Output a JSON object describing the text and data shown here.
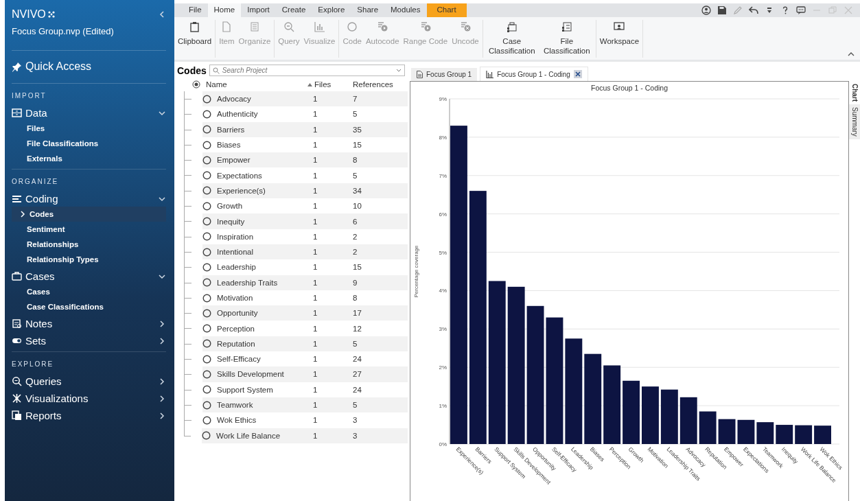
{
  "sidebar": {
    "logo": "NVIVO",
    "project": "Focus Group.nvp (Edited)",
    "quick_access": "Quick Access",
    "sections": [
      {
        "heading": "IMPORT",
        "groups": [
          {
            "label": "Data",
            "expanded": true,
            "children": [
              {
                "label": "Files",
                "selected": false
              },
              {
                "label": "File Classifications",
                "selected": false
              },
              {
                "label": "Externals",
                "selected": false
              }
            ]
          }
        ]
      },
      {
        "heading": "ORGANIZE",
        "groups": [
          {
            "label": "Coding",
            "expanded": true,
            "children": [
              {
                "label": "Codes",
                "selected": true
              },
              {
                "label": "Sentiment",
                "selected": false
              },
              {
                "label": "Relationships",
                "selected": false
              },
              {
                "label": "Relationship Types",
                "selected": false
              }
            ]
          },
          {
            "label": "Cases",
            "expanded": true,
            "children": [
              {
                "label": "Cases",
                "selected": false
              },
              {
                "label": "Case Classifications",
                "selected": false
              }
            ]
          },
          {
            "label": "Notes",
            "expanded": false
          },
          {
            "label": "Sets",
            "expanded": false
          }
        ]
      },
      {
        "heading": "EXPLORE",
        "groups": [
          {
            "label": "Queries",
            "expanded": false
          },
          {
            "label": "Visualizations",
            "expanded": false
          },
          {
            "label": "Reports",
            "expanded": false
          }
        ]
      }
    ]
  },
  "ribbon": {
    "tabs": [
      {
        "label": "File",
        "selected": false,
        "kind": "plain"
      },
      {
        "label": "Home",
        "selected": true,
        "kind": "plain"
      },
      {
        "label": "Import",
        "selected": false,
        "kind": "plain"
      },
      {
        "label": "Create",
        "selected": false,
        "kind": "plain"
      },
      {
        "label": "Explore",
        "selected": false,
        "kind": "plain"
      },
      {
        "label": "Share",
        "selected": false,
        "kind": "plain"
      },
      {
        "label": "Modules",
        "selected": false,
        "kind": "plain"
      },
      {
        "label": "Chart",
        "selected": false,
        "kind": "context"
      }
    ],
    "groups": [
      [
        {
          "label": "Clipboard",
          "disabled": false
        }
      ],
      [
        {
          "label": "Item",
          "disabled": true
        },
        {
          "label": "Organize",
          "disabled": true
        }
      ],
      [
        {
          "label": "Query",
          "disabled": true
        },
        {
          "label": "Visualize",
          "disabled": true
        }
      ],
      [
        {
          "label": "Code",
          "disabled": true
        },
        {
          "label": "Autocode",
          "disabled": true
        },
        {
          "label": "Range Code",
          "disabled": true
        },
        {
          "label": "Uncode",
          "disabled": true
        }
      ],
      [
        {
          "label": "Case Classification",
          "disabled": false
        },
        {
          "label": "File Classification",
          "disabled": false
        }
      ],
      [
        {
          "label": "Workspace",
          "disabled": false
        }
      ]
    ]
  },
  "codes": {
    "title": "Codes",
    "search": {
      "placeholder": "Search Project"
    },
    "columns": [
      "Name",
      "Files",
      "References"
    ],
    "rows": [
      {
        "name": "Advocacy",
        "files": "1",
        "references": "7"
      },
      {
        "name": "Authenticity",
        "files": "1",
        "references": "5"
      },
      {
        "name": "Barriers",
        "files": "1",
        "references": "35"
      },
      {
        "name": "Biases",
        "files": "1",
        "references": "15"
      },
      {
        "name": "Empower",
        "files": "1",
        "references": "8"
      },
      {
        "name": "Expectations",
        "files": "1",
        "references": "5"
      },
      {
        "name": "Experience(s)",
        "files": "1",
        "references": "34"
      },
      {
        "name": "Growth",
        "files": "1",
        "references": "10"
      },
      {
        "name": "Inequity",
        "files": "1",
        "references": "6"
      },
      {
        "name": "Inspiration",
        "files": "1",
        "references": "2"
      },
      {
        "name": "Intentional",
        "files": "1",
        "references": "2"
      },
      {
        "name": "Leadership",
        "files": "1",
        "references": "15"
      },
      {
        "name": "Leadership Traits",
        "files": "1",
        "references": "9"
      },
      {
        "name": "Motivation",
        "files": "1",
        "references": "8"
      },
      {
        "name": "Opportunity",
        "files": "1",
        "references": "17"
      },
      {
        "name": "Perception",
        "files": "1",
        "references": "12"
      },
      {
        "name": "Reputation",
        "files": "1",
        "references": "5"
      },
      {
        "name": "Self-Efficacy",
        "files": "1",
        "references": "24"
      },
      {
        "name": "Skills Development",
        "files": "1",
        "references": "27"
      },
      {
        "name": "Support System",
        "files": "1",
        "references": "24"
      },
      {
        "name": "Teamwork",
        "files": "1",
        "references": "5"
      },
      {
        "name": "Wok Ethics",
        "files": "1",
        "references": "3"
      },
      {
        "name": "Work Life Balance",
        "files": "1",
        "references": "3"
      }
    ]
  },
  "documents": {
    "tabs": [
      {
        "label": "Focus Group 1",
        "selected": false,
        "kind": "document"
      },
      {
        "label": "Focus Group 1 - Coding",
        "selected": true,
        "kind": "chart"
      }
    ],
    "side_tabs": [
      {
        "label": "Chart",
        "selected": true
      },
      {
        "label": "Summary",
        "selected": false
      }
    ],
    "chart_data": {
      "type": "bar",
      "title": "Focus Group 1 - Coding",
      "ylabel": "Percentage coverage",
      "categories": [
        "Experience(s)",
        "Barriers",
        "Support System",
        "Skills Development",
        "Opportunity",
        "Self-Efficacy",
        "Leadership",
        "Biases",
        "Perception",
        "Growth",
        "Motivation",
        "Leadership Traits",
        "Advocacy",
        "Reputation",
        "Empower",
        "Expectations",
        "Teamwork",
        "Inequity",
        "Work Life Balance",
        "Wok Ethics"
      ],
      "values": [
        8.3,
        6.6,
        4.25,
        4.1,
        3.6,
        3.3,
        2.75,
        2.35,
        2.05,
        1.65,
        1.5,
        1.42,
        1.22,
        0.85,
        0.65,
        0.63,
        0.57,
        0.5,
        0.49,
        0.48
      ],
      "grid": true,
      "ylim": [
        0,
        9
      ],
      "yticks": [
        {
          "value": 0,
          "label": "0%"
        },
        {
          "value": 1,
          "label": "1%"
        },
        {
          "value": 2,
          "label": "2%"
        },
        {
          "value": 3,
          "label": "3%"
        },
        {
          "value": 4,
          "label": "4%"
        },
        {
          "value": 5,
          "label": "5%"
        },
        {
          "value": 6,
          "label": "6%"
        },
        {
          "value": 7,
          "label": "7%"
        },
        {
          "value": 8,
          "label": "8%"
        },
        {
          "value": 9,
          "label": "9%"
        }
      ]
    }
  }
}
